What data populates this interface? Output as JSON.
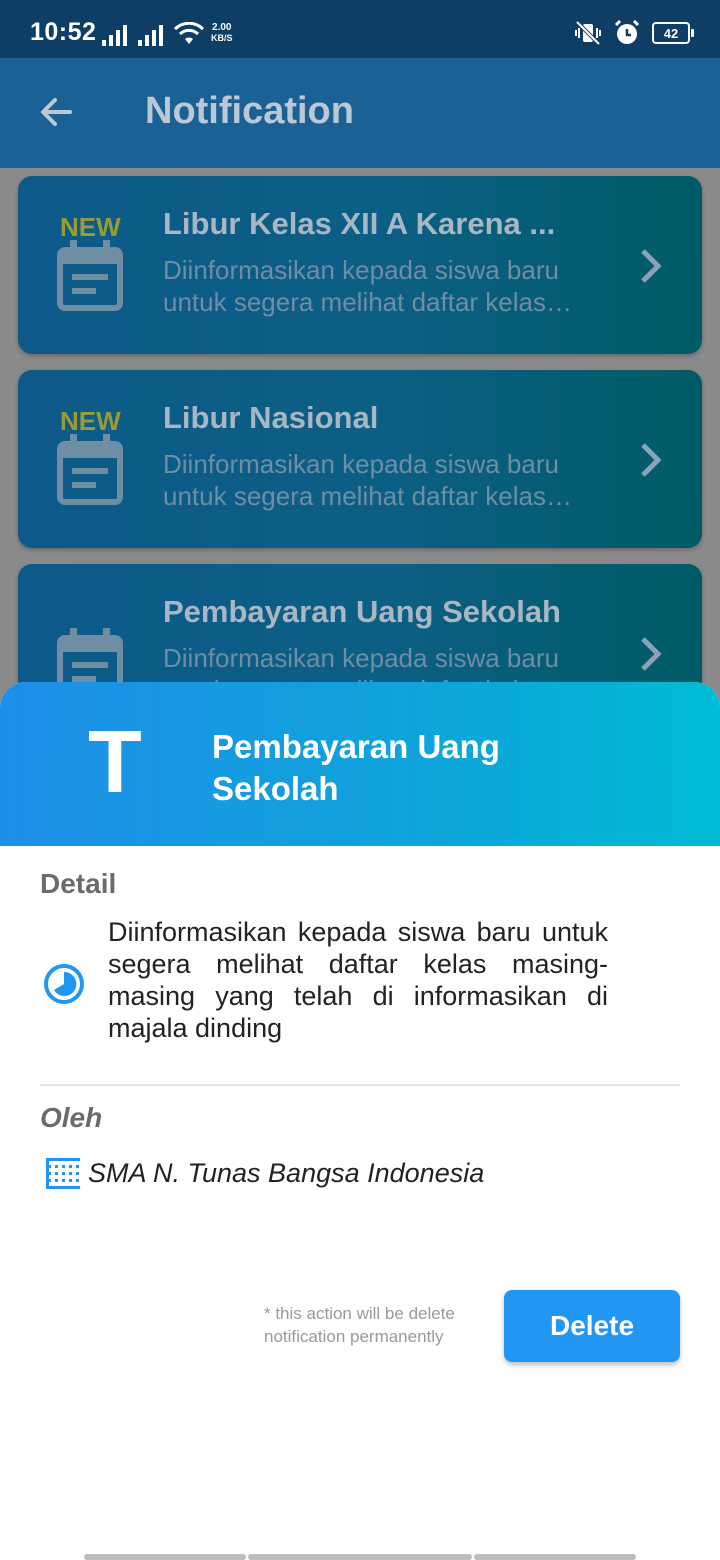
{
  "status_bar": {
    "time": "10:52",
    "net_speed_value": "2.00",
    "net_speed_unit": "KB/S",
    "battery": "42"
  },
  "app_bar": {
    "title": "Notification",
    "back_icon": "arrow-left-icon"
  },
  "notifications": [
    {
      "badge": "NEW",
      "title": "Libur Kelas XII A Karena ...",
      "body": "Diinformasikan kepada siswa baru untuk segera melihat daftar kelas…"
    },
    {
      "badge": "NEW",
      "title": "Libur Nasional",
      "body": "Diinformasikan kepada siswa baru untuk segera melihat daftar kelas…"
    },
    {
      "badge": "",
      "title": "Pembayaran Uang Sekolah",
      "body": "Diinformasikan kepada siswa baru untuk segera melihat daftar kelas…"
    }
  ],
  "sheet": {
    "avatar_letter": "T",
    "title": "Pembayaran Uang Sekolah",
    "detail_label": "Detail",
    "detail_text": "Diinformasikan kepada siswa baru untuk segera melihat daftar kelas masing-masing yang telah di informasikan di majala dinding",
    "by_label": "Oleh",
    "by_value": "SMA N. Tunas Bangsa Indonesia",
    "note_line1": "* this action will be delete",
    "note_line2": "notification permanently",
    "delete_label": "Delete"
  },
  "colors": {
    "app_bar": "#1a6296",
    "status_bar": "#0e3d66",
    "accent": "#2196f3",
    "new_badge": "#9a9a36"
  }
}
